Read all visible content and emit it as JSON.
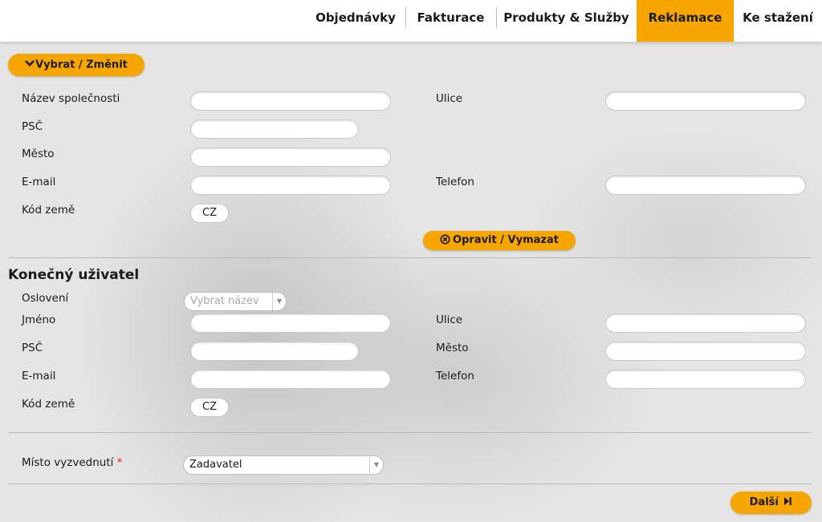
{
  "nav": {
    "items": [
      {
        "label": "Objednávky"
      },
      {
        "label": "Fakturace"
      },
      {
        "label": "Produkty & Služby"
      },
      {
        "label": "Reklamace"
      },
      {
        "label": "Ke stažení"
      }
    ],
    "active_color": "#f7a600"
  },
  "requester": {
    "select_change_label": "Vybrat / Změnit",
    "company_label": "Název společnosti",
    "street_label": "Ulice",
    "zip_label": "PSČ",
    "city_label": "Město",
    "email_label": "E-mail",
    "phone_label": "Telefon",
    "country_code_label": "Kód země",
    "country_code_value": "CZ",
    "fix_clear_label": "Opravit / Vymazat"
  },
  "end_user": {
    "heading": "Konečný uživatel",
    "salutation_label": "Oslovení",
    "salutation_placeholder": "Vybrat název",
    "name_label": "Jméno",
    "street_label": "Ulice",
    "zip_label": "PSČ",
    "city_label": "Město",
    "email_label": "E-mail",
    "phone_label": "Telefon",
    "country_code_label": "Kód země",
    "country_code_value": "CZ"
  },
  "pickup": {
    "label": "Místo vyzvednutí",
    "required_mark": "*",
    "selected_value": "Zadavatel"
  },
  "footer": {
    "next_label": "Další"
  }
}
